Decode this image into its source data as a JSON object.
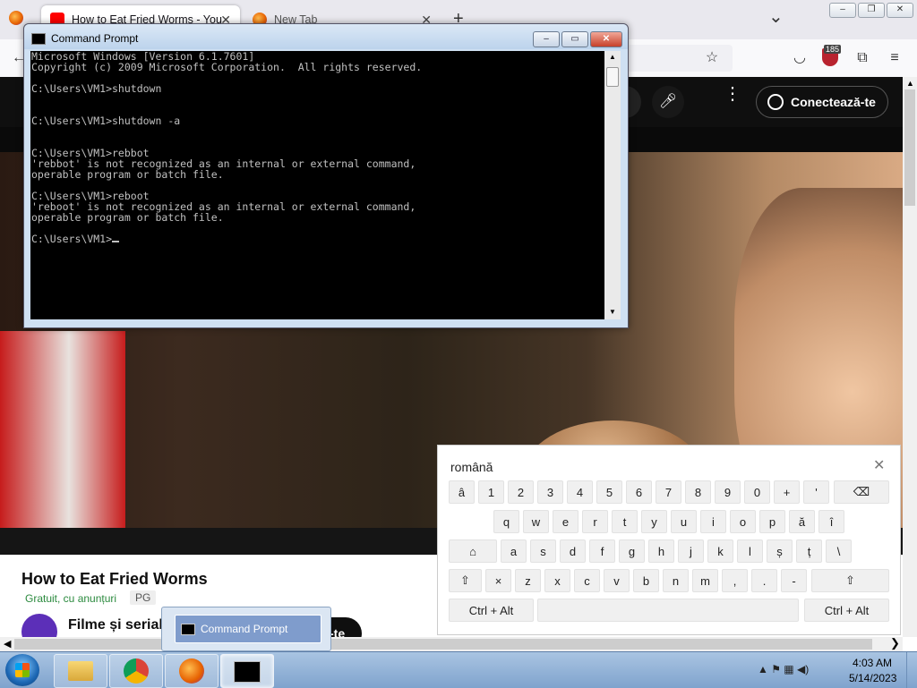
{
  "browser": {
    "tabs": [
      {
        "label": "How to Eat Fried Worms - YouT",
        "active": true
      },
      {
        "label": "New Tab",
        "active": false
      }
    ],
    "new_tab_label": "+",
    "list_tabs_label": "⌄",
    "notification_badge": "185",
    "window_controls": [
      "–",
      "❐",
      "✕"
    ]
  },
  "youtube": {
    "connect_label": "Conectează-te",
    "video_title": "How to Eat Fried Worms",
    "subtitle": "Gratuit, cu anunțuri",
    "rating": "PG",
    "channel_name": "Filme și seriale",
    "partial_button": "-te"
  },
  "cmd": {
    "title": "Command Prompt",
    "lines": [
      "Microsoft Windows [Version 6.1.7601]",
      "Copyright (c) 2009 Microsoft Corporation.  All rights reserved.",
      "",
      "C:\\Users\\VM1>shutdown",
      "",
      "",
      "C:\\Users\\VM1>shutdown -a",
      "",
      "",
      "C:\\Users\\VM1>rebbot",
      "'rebbot' is not recognized as an internal or external command,",
      "operable program or batch file.",
      "",
      "C:\\Users\\VM1>reboot",
      "'reboot' is not recognized as an internal or external command,",
      "operable program or batch file.",
      "",
      "C:\\Users\\VM1>"
    ]
  },
  "keyboard": {
    "language": "română",
    "close_label": "✕",
    "row1": [
      "â",
      "1",
      "2",
      "3",
      "4",
      "5",
      "6",
      "7",
      "8",
      "9",
      "0",
      "+",
      "'"
    ],
    "backspace_label": "⌫",
    "row2": [
      "q",
      "w",
      "e",
      "r",
      "t",
      "y",
      "u",
      "i",
      "o",
      "p",
      "ă",
      "î"
    ],
    "home_label": "⌂",
    "row3": [
      "a",
      "s",
      "d",
      "f",
      "g",
      "h",
      "j",
      "k",
      "l",
      "ș",
      "ț",
      "\\"
    ],
    "shift_label": "⇧",
    "row4": [
      "×",
      "z",
      "x",
      "c",
      "v",
      "b",
      "n",
      "m",
      ",",
      ".",
      "-"
    ],
    "ctrl_alt_label": "Ctrl + Alt"
  },
  "taskbar": {
    "time": "4:03 AM",
    "date": "5/14/2023",
    "thumbnail_label": "Command Prompt",
    "tray": "▲  ⚑  ▦  ◀)"
  },
  "colors": {
    "youtube_dark": "#0f0f0f",
    "console_bg": "#000000",
    "console_fg": "#c0c0c0",
    "taskbar": "#8fb0d6"
  }
}
